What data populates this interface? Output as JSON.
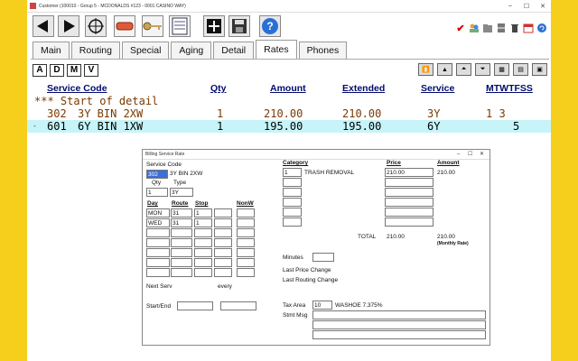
{
  "window": {
    "title": "Customer (100010 - Group 5 - MCDONALDS #123 - 0001 CASINO WAY)"
  },
  "tabs": [
    {
      "label": "Main"
    },
    {
      "label": "Routing"
    },
    {
      "label": "Special"
    },
    {
      "label": "Aging"
    },
    {
      "label": "Detail"
    },
    {
      "label": "Rates"
    },
    {
      "label": "Phones"
    }
  ],
  "active_tab": "Rates",
  "record_buttons": [
    "A",
    "D",
    "M",
    "V"
  ],
  "grid": {
    "headers": {
      "service_code": "Service Code",
      "qty": "Qty",
      "amount": "Amount",
      "extended": "Extended",
      "service": "Service",
      "days": "MTWTFSS"
    },
    "start_row": "*** Start of detail",
    "rows": [
      {
        "code": "302",
        "desc": "3Y BIN 2XW",
        "qty": "1",
        "amount": "210.00",
        "extended": "210.00",
        "service": "3Y",
        "days": "1 3"
      },
      {
        "code": "601",
        "desc": "6Y BIN 1XW",
        "qty": "1",
        "amount": "195.00",
        "extended": "195.00",
        "service": "6Y",
        "days": "5"
      }
    ]
  },
  "dialog": {
    "title": "Billing Service Rate",
    "service_code_label": "Service Code",
    "service_code": "302",
    "service_desc": "3Y BIN 2XW",
    "qty_label": "Qty",
    "type_label": "Type",
    "qty": "1",
    "type": "3Y",
    "day_label": "Day",
    "route_label": "Route",
    "stop_label": "Stop",
    "nonw_label": "NonW",
    "schedule": [
      {
        "day": "MON",
        "route": "31",
        "stop": "1"
      },
      {
        "day": "WED",
        "route": "31",
        "stop": "1"
      }
    ],
    "next_serv_label": "Next Serv",
    "every_label": "every",
    "start_end_label": "Start/End",
    "category_label": "Category",
    "price_label": "Price",
    "amount_label": "Amount",
    "category_code": "1",
    "category_desc": "TRASH REMOVAL",
    "price": "210.00",
    "amount": "210.00",
    "total_label": "TOTAL",
    "total_price": "210.00",
    "total_amount": "210.00",
    "monthly_rate": "(Monthly Rate)",
    "minutes_label": "Minutes",
    "last_price_change_label": "Last Price Change",
    "last_routing_change_label": "Last Routing Change",
    "tax_area_label": "Tax Area",
    "tax_area_code": "10",
    "tax_area_desc": "WASHOE 7.375%",
    "stmt_msg_label": "Stmt Msg"
  },
  "colors": {
    "header_blue": "#000b6e",
    "row_brown": "#7a3a00",
    "selected_row": "#c6f4f8",
    "frame_yellow": "#f5cf1c"
  }
}
